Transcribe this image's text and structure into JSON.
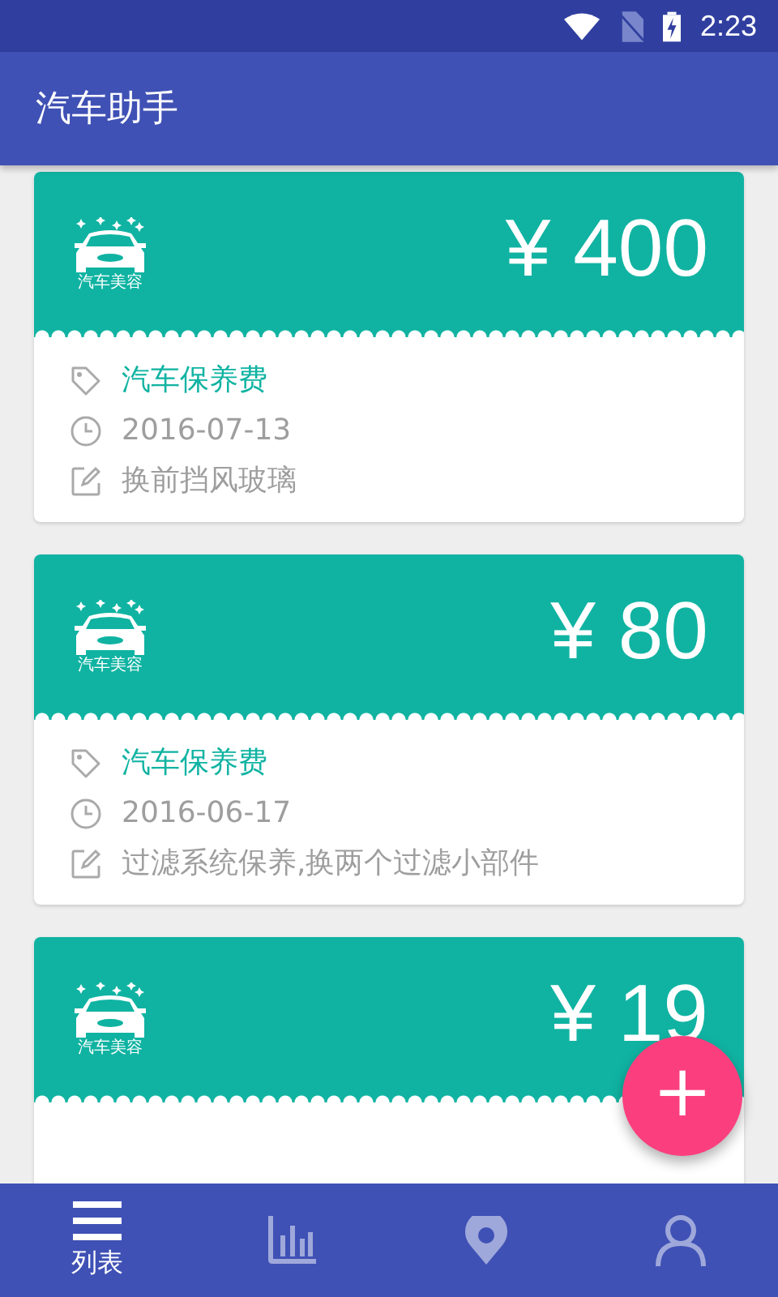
{
  "status_bar": {
    "time": "2:23"
  },
  "app_bar": {
    "title": "汽车助手"
  },
  "records": [
    {
      "logo_caption": "汽车美容",
      "amount": "¥ 400",
      "details": [
        {
          "kind": "category",
          "text": "汽车保养费"
        },
        {
          "kind": "date",
          "text": "2016-07-13"
        },
        {
          "kind": "note",
          "text": "换前挡风玻璃"
        }
      ]
    },
    {
      "logo_caption": "汽车美容",
      "amount": "¥ 80",
      "details": [
        {
          "kind": "category",
          "text": "汽车保养费"
        },
        {
          "kind": "date",
          "text": "2016-06-17"
        },
        {
          "kind": "note",
          "text": "过滤系统保养,换两个过滤小部件"
        }
      ]
    },
    {
      "logo_caption": "汽车美容",
      "amount": "¥ 19"
    }
  ],
  "fab": {
    "label": "+"
  },
  "bottom_nav": [
    {
      "kind": "list",
      "label": "列表",
      "selected": true
    },
    {
      "kind": "chart",
      "selected": false
    },
    {
      "kind": "pin",
      "selected": false
    },
    {
      "kind": "person",
      "selected": false
    }
  ]
}
